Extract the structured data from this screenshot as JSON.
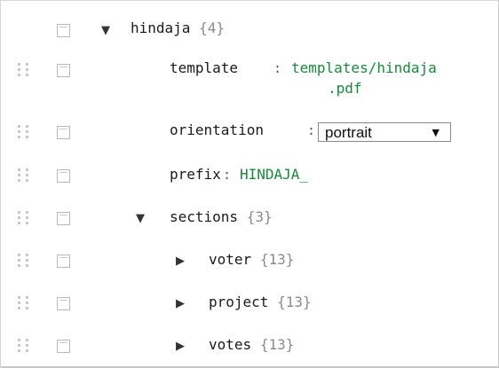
{
  "tree": {
    "root": {
      "key": "hindaja",
      "count": "{4}",
      "arrow": "▼"
    },
    "template": {
      "key": "template",
      "sep": ":",
      "value_line1": "templates/hindaja",
      "value_line2": ".pdf"
    },
    "orientation": {
      "key": "orientation",
      "sep": ":",
      "selected": "portrait",
      "caret": "▼"
    },
    "prefix": {
      "key": "prefix",
      "sep": ":",
      "value": "HINDAJA_"
    },
    "sections": {
      "key": "sections",
      "count": "{3}",
      "arrow": "▼"
    },
    "voter": {
      "key": "voter",
      "count": "{13}",
      "arrow": "▶"
    },
    "project": {
      "key": "project",
      "count": "{13}",
      "arrow": "▶"
    },
    "votes": {
      "key": "votes",
      "count": "{13}",
      "arrow": "▶"
    }
  },
  "icons": {
    "drag": "drag-handle-icon",
    "checkbox": "checkbox-icon"
  },
  "colors": {
    "value": "#168a3a",
    "count": "#8a8a8a",
    "handle": "#c8c8c8"
  }
}
